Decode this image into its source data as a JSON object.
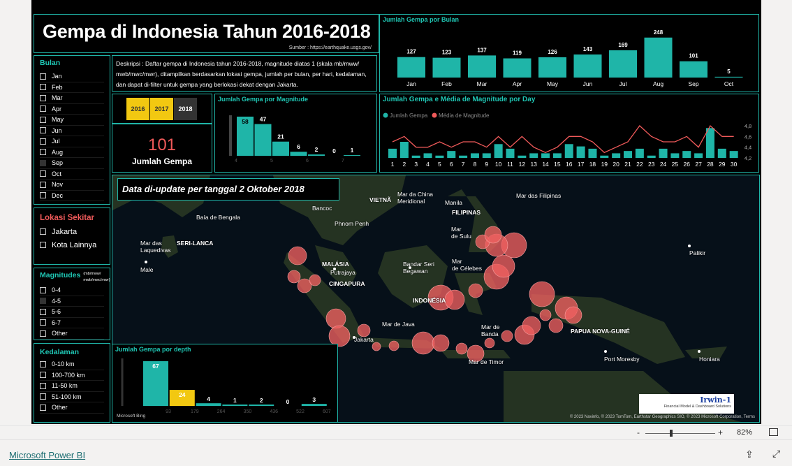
{
  "report": {
    "title": "Gempa di Indonesia Tahun 2016-2018",
    "source": "Sumber : https://earthquake.usgs.gov/",
    "description": "Deskripsi : Daftar gempa di Indonesia tahun 2016-2018, magnitude diatas 1 (skala mb/mww/ mwb/mwc/mwr), ditampilkan berdasarkan lokasi gempa, jumlah per bulan, per hari, kedalaman, dan dapat di-filter untuk gempa yang berlokasi dekat dengan Jakarta.",
    "years": [
      "2016",
      "2017",
      "2018"
    ],
    "kpi": {
      "value": "101",
      "label": "Jumlah Gempa"
    },
    "update_note": "Data di-update per tanggal 2 Oktober 2018"
  },
  "slicers": {
    "bulan": {
      "title": "Bulan",
      "items": [
        "Jan",
        "Feb",
        "Mar",
        "Apr",
        "May",
        "Jun",
        "Jul",
        "Aug",
        "Sep",
        "Oct",
        "Nov",
        "Dec"
      ],
      "selected": "Sep"
    },
    "lokasi": {
      "title": "Lokasi Sekitar",
      "items": [
        "Jakarta",
        "Kota Lainnya"
      ]
    },
    "magnitudes": {
      "title": "Magnitudes",
      "subtitle": "(mb/mww/ mwb/mwc/mwr)",
      "items": [
        "0-4",
        "4-5",
        "5-6",
        "6-7",
        "Other"
      ],
      "selected": "4-5"
    },
    "kedalaman": {
      "title": "Kedalaman",
      "items": [
        "0-10 km",
        "100-700 km",
        "11-50 km",
        "51-100 km",
        "Other"
      ]
    }
  },
  "chart_data": [
    {
      "type": "bar",
      "title": "Jumlah Gempa por Bulan",
      "categories": [
        "Jan",
        "Feb",
        "Mar",
        "Apr",
        "May",
        "Jun",
        "Jul",
        "Aug",
        "Sep",
        "Oct"
      ],
      "values": [
        127,
        123,
        137,
        119,
        126,
        143,
        169,
        248,
        101,
        5
      ]
    },
    {
      "type": "bar",
      "title": "Jumlah Gempa por Magnitude",
      "categories": [
        "4",
        "5",
        "6",
        "7",
        "8"
      ],
      "values": [
        58,
        47,
        21,
        6,
        2,
        0,
        1
      ]
    },
    {
      "type": "bar",
      "title": "Jumlah Gempa e Média de Magnitude por Day",
      "legend": [
        "Jumlah Gempa",
        "Média de Magnitude"
      ],
      "categories": [
        "1",
        "2",
        "3",
        "4",
        "5",
        "6",
        "7",
        "8",
        "9",
        "10",
        "11",
        "12",
        "13",
        "14",
        "15",
        "16",
        "17",
        "18",
        "19",
        "20",
        "21",
        "22",
        "23",
        "24",
        "25",
        "26",
        "27",
        "28",
        "29",
        "30"
      ],
      "series": [
        {
          "name": "Jumlah Gempa",
          "values": [
            4,
            7,
            1,
            2,
            1,
            3,
            1,
            2,
            2,
            6,
            4,
            1,
            2,
            2,
            2,
            6,
            5,
            4,
            1,
            2,
            3,
            4,
            1,
            4,
            2,
            3,
            2,
            13,
            4,
            3
          ]
        },
        {
          "name": "Média de Magnitude",
          "values": [
            4.5,
            4.6,
            4.4,
            4.4,
            4.5,
            4.4,
            4.5,
            4.5,
            4.4,
            4.6,
            4.4,
            4.6,
            4.4,
            4.3,
            4.4,
            4.6,
            4.6,
            4.5,
            4.3,
            4.4,
            4.5,
            4.8,
            4.6,
            4.5,
            4.5,
            4.6,
            4.4,
            4.8,
            4.6,
            4.6
          ]
        }
      ],
      "y_ticks": [
        "4,2",
        "4,4",
        "4,6",
        "4,8"
      ]
    },
    {
      "type": "bar",
      "title": "Jumlah Gempa por depth",
      "categories": [
        "93",
        "179",
        "264",
        "350",
        "436",
        "522",
        "607"
      ],
      "values": [
        67,
        24,
        4,
        1,
        2,
        0,
        3
      ]
    }
  ],
  "map": {
    "labels": [
      {
        "t": "Baía de Bengala",
        "x": 120,
        "y": 55
      },
      {
        "t": "SERI-LANCA",
        "x": 92,
        "y": 92
      },
      {
        "t": "Mar das\nLaquedivas",
        "x": 40,
        "y": 92
      },
      {
        "t": "Male",
        "x": 40,
        "y": 130
      },
      {
        "t": "Bancoc",
        "x": 286,
        "y": 42
      },
      {
        "t": "Phnom Penh",
        "x": 318,
        "y": 64
      },
      {
        "t": "VIETNÃ",
        "x": 368,
        "y": 30
      },
      {
        "t": "Mar da China\nMeridional",
        "x": 408,
        "y": 22
      },
      {
        "t": "Manila",
        "x": 476,
        "y": 34
      },
      {
        "t": "FILIPINAS",
        "x": 486,
        "y": 48
      },
      {
        "t": "Mar das Filipinas",
        "x": 578,
        "y": 24
      },
      {
        "t": "Mar\nde Sulu",
        "x": 485,
        "y": 72
      },
      {
        "t": "MALÁSIA",
        "x": 300,
        "y": 122
      },
      {
        "t": "Putrajaya",
        "x": 312,
        "y": 134
      },
      {
        "t": "CINGAPURA",
        "x": 310,
        "y": 150
      },
      {
        "t": "Bandar Seri\nBegawan",
        "x": 416,
        "y": 122
      },
      {
        "t": "Mar\nde Célebes",
        "x": 486,
        "y": 118
      },
      {
        "t": "Palikir",
        "x": 826,
        "y": 106
      },
      {
        "t": "INDONÉSIA",
        "x": 430,
        "y": 174
      },
      {
        "t": "Mar de Java",
        "x": 386,
        "y": 208
      },
      {
        "t": "Jakarta",
        "x": 346,
        "y": 230
      },
      {
        "t": "Mar de\nBanda",
        "x": 528,
        "y": 212
      },
      {
        "t": "PAPUA NOVA-GUINÉ",
        "x": 656,
        "y": 218
      },
      {
        "t": "Port Moresby",
        "x": 704,
        "y": 258
      },
      {
        "t": "Honiara",
        "x": 840,
        "y": 258
      },
      {
        "t": "Mar de Timor",
        "x": 510,
        "y": 262
      }
    ],
    "attribution": "© 2023 Navinfo, © 2023 TomTom, Earthstar Geographics SIO, © 2023 Microsoft Corporation, Terms",
    "bing": "Microsoft Bing",
    "brand_name": "Irwin-1",
    "brand_sub": "Financial Model & Dashboard Solutions"
  },
  "footer": {
    "link": "Microsoft Power BI",
    "zoom": "82%"
  },
  "colors": {
    "teal": "#1fb5a8",
    "yellow": "#f2c811",
    "red": "#f05a5a",
    "bg": "#000000"
  }
}
